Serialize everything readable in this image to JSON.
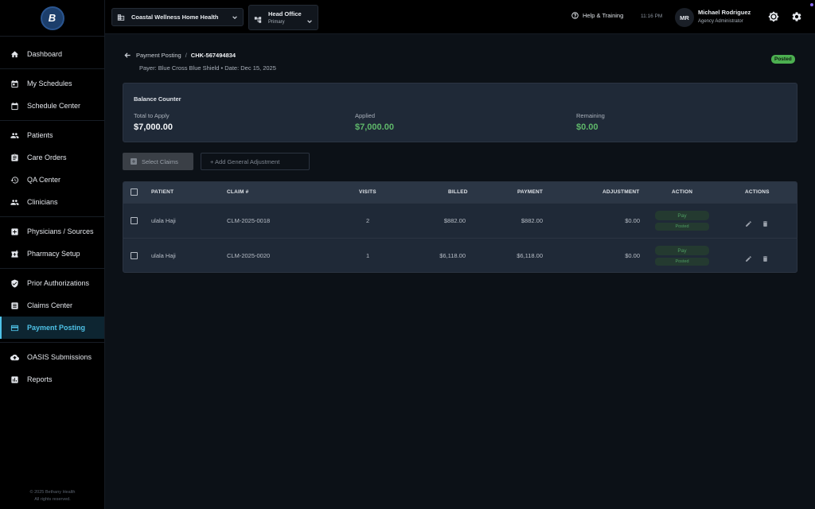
{
  "app": {
    "logo_text": "B"
  },
  "sidebar": {
    "items": [
      {
        "label": "Dashboard",
        "icon": "home-icon"
      },
      {
        "label": "My Schedules",
        "icon": "calendar-today-icon"
      },
      {
        "label": "Schedule Center",
        "icon": "calendar-icon"
      },
      {
        "label": "Patients",
        "icon": "people-icon"
      },
      {
        "label": "Care Orders",
        "icon": "clipboard-icon"
      },
      {
        "label": "QA Center",
        "icon": "history-icon"
      },
      {
        "label": "Clinicians",
        "icon": "group-icon"
      },
      {
        "label": "Physicians / Sources",
        "icon": "medical-plus-icon"
      },
      {
        "label": "Pharmacy Setup",
        "icon": "pharmacy-icon"
      },
      {
        "label": "Prior Authorizations",
        "icon": "shield-check-icon"
      },
      {
        "label": "Claims Center",
        "icon": "list-doc-icon"
      },
      {
        "label": "Payment Posting",
        "icon": "credit-card-icon",
        "active": true
      },
      {
        "label": "OASIS Submissions",
        "icon": "cloud-upload-icon"
      },
      {
        "label": "Reports",
        "icon": "bar-chart-icon"
      }
    ],
    "footer_line1": "© 2025 Bethany Health",
    "footer_line2": "All rights reserved."
  },
  "topbar": {
    "org_name": "Coastal Wellness Home Health",
    "office_name": "Head Office",
    "office_type": "Primary",
    "help_label": "Help & Training",
    "time": "11:16 PM",
    "avatar_initials": "MR",
    "user_name": "Michael Rodriguez",
    "user_role": "Agency Administrator"
  },
  "page": {
    "breadcrumb_parent": "Payment Posting",
    "breadcrumb_sep": "/",
    "check_id": "CHK-567494834",
    "payer_line": "Payer: Blue Cross Blue Shield • Date: Dec 15, 2025",
    "status": "Posted"
  },
  "balance": {
    "title": "Balance Counter",
    "total_label": "Total to Apply",
    "total_value": "$7,000.00",
    "applied_label": "Applied",
    "applied_value": "$7,000.00",
    "remaining_label": "Remaining",
    "remaining_value": "$0.00"
  },
  "actions": {
    "select_claims": "Select Claims",
    "add_adjustment": "+ Add General Adjustment"
  },
  "table": {
    "headers": {
      "patient": "PATIENT",
      "claim": "CLAIM #",
      "visits": "VISITS",
      "billed": "BILLED",
      "payment": "PAYMENT",
      "adjustment": "ADJUSTMENT",
      "action": "ACTION",
      "actions": "ACTIONS"
    },
    "rows": [
      {
        "patient": "ulala Haji",
        "claim": "CLM-2025-0018",
        "visits": "2",
        "billed": "$882.00",
        "payment": "$882.00",
        "adjustment": "$0.00",
        "pay_label": "Pay",
        "posted_label": "Posted"
      },
      {
        "patient": "ulala Haji",
        "claim": "CLM-2025-0020",
        "visits": "1",
        "billed": "$6,118.00",
        "payment": "$6,118.00",
        "adjustment": "$0.00",
        "pay_label": "Pay",
        "posted_label": "Posted"
      }
    ]
  }
}
